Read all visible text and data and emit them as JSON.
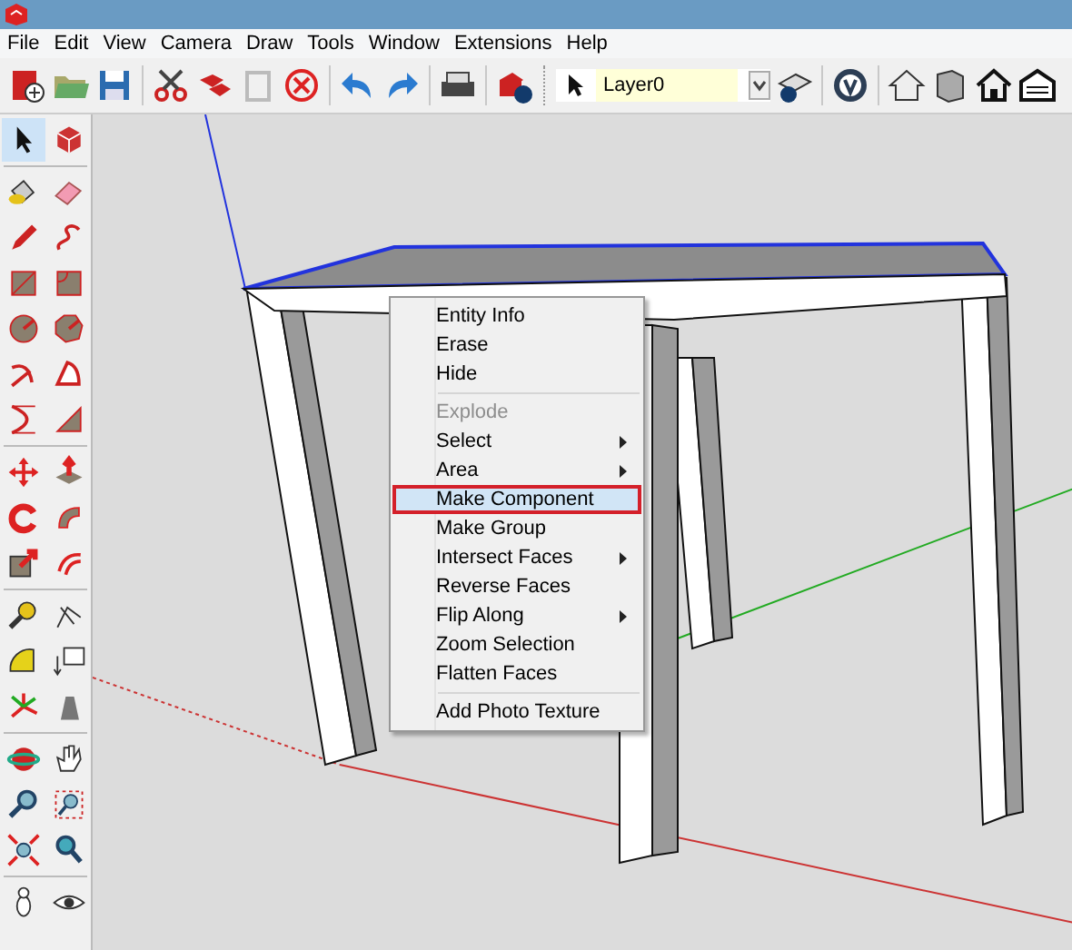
{
  "menu_bar": [
    "File",
    "Edit",
    "View",
    "Camera",
    "Draw",
    "Tools",
    "Window",
    "Extensions",
    "Help"
  ],
  "layer_field": {
    "value": "Layer0"
  },
  "tool_palette": [
    {
      "kind": "select",
      "selected": true
    },
    {
      "kind": "component",
      "selected": false
    },
    {
      "kind": "paint",
      "selected": false
    },
    {
      "kind": "eraser",
      "selected": false
    },
    {
      "kind": "pencil",
      "selected": false
    },
    {
      "kind": "freehand",
      "selected": false
    },
    {
      "kind": "rectangle",
      "selected": false
    },
    {
      "kind": "rotrect",
      "selected": false
    },
    {
      "kind": "circle",
      "selected": false
    },
    {
      "kind": "polygon",
      "selected": false
    },
    {
      "kind": "arc",
      "selected": false
    },
    {
      "kind": "pie",
      "selected": false
    },
    {
      "kind": "arc3",
      "selected": false
    },
    {
      "kind": "triangle",
      "selected": false
    },
    {
      "kind": "move",
      "selected": false
    },
    {
      "kind": "pushpull",
      "selected": false
    },
    {
      "kind": "rotate",
      "selected": false
    },
    {
      "kind": "followme",
      "selected": false
    },
    {
      "kind": "scale",
      "selected": false
    },
    {
      "kind": "offset",
      "selected": false
    },
    {
      "kind": "tape",
      "selected": false
    },
    {
      "kind": "dimension",
      "selected": false
    },
    {
      "kind": "protractor",
      "selected": false
    },
    {
      "kind": "text",
      "selected": false
    },
    {
      "kind": "axes",
      "selected": false
    },
    {
      "kind": "section",
      "selected": false
    },
    {
      "kind": "orbit",
      "selected": false
    },
    {
      "kind": "pan",
      "selected": false
    },
    {
      "kind": "zoom",
      "selected": false
    },
    {
      "kind": "zoomwindow",
      "selected": false
    },
    {
      "kind": "extents",
      "selected": false
    },
    {
      "kind": "previous",
      "selected": false
    },
    {
      "kind": "walk",
      "selected": false
    },
    {
      "kind": "look",
      "selected": false
    }
  ],
  "context_menu": [
    [
      {
        "label": "Entity Info",
        "disabled": false,
        "submenu": false,
        "selected": false
      },
      {
        "label": "Erase",
        "disabled": false,
        "submenu": false,
        "selected": false
      },
      {
        "label": "Hide",
        "disabled": false,
        "submenu": false,
        "selected": false
      }
    ],
    [
      {
        "label": "Explode",
        "disabled": true,
        "submenu": false,
        "selected": false
      },
      {
        "label": "Select",
        "disabled": false,
        "submenu": true,
        "selected": false
      },
      {
        "label": "Area",
        "disabled": false,
        "submenu": true,
        "selected": false
      },
      {
        "label": "Make Component",
        "disabled": false,
        "submenu": false,
        "selected": true
      },
      {
        "label": "Make Group",
        "disabled": false,
        "submenu": false,
        "selected": false
      },
      {
        "label": "Intersect Faces",
        "disabled": false,
        "submenu": true,
        "selected": false
      },
      {
        "label": "Reverse Faces",
        "disabled": false,
        "submenu": false,
        "selected": false
      },
      {
        "label": "Flip Along",
        "disabled": false,
        "submenu": true,
        "selected": false
      },
      {
        "label": "Zoom Selection",
        "disabled": false,
        "submenu": false,
        "selected": false
      },
      {
        "label": "Flatten Faces",
        "disabled": false,
        "submenu": false,
        "selected": false
      }
    ],
    [
      {
        "label": "Add Photo Texture",
        "disabled": false,
        "submenu": false,
        "selected": false
      }
    ]
  ]
}
